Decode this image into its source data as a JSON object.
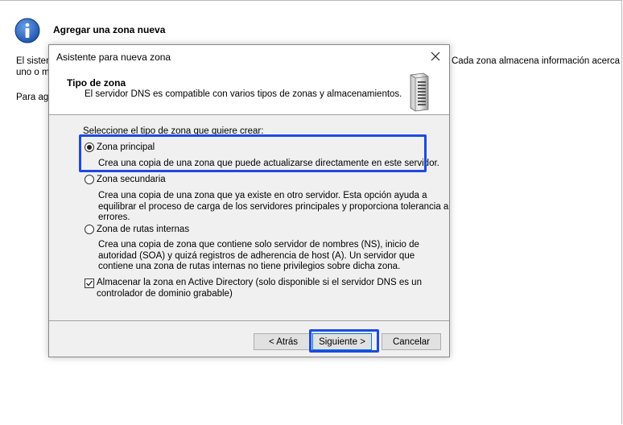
{
  "background": {
    "title": "Agregar una zona nueva",
    "line1_left": "El sistem",
    "line1_right": "Cada zona almacena información acerca",
    "line2_left": "uno o m",
    "line3_left": "Para agr"
  },
  "dialog": {
    "title": "Asistente para nueva zona",
    "header_title": "Tipo de zona",
    "header_subtitle": "El servidor DNS es compatible con varios tipos de zonas y almacenamientos.",
    "prompt": "Seleccione el tipo de zona que quiere crear:",
    "options": [
      {
        "label": "Zona principal",
        "selected": true,
        "desc": [
          "Crea una copia de una zona que puede actualizarse directamente en este servidor."
        ]
      },
      {
        "label": "Zona secundaria",
        "selected": false,
        "desc": [
          "Crea una copia de una zona que ya existe en otro servidor. Esta opción ayuda a",
          "equilibrar el proceso de carga de los servidores principales y proporciona tolerancia a",
          "errores."
        ]
      },
      {
        "label": "Zona de rutas internas",
        "selected": false,
        "desc": [
          "Crea una copia de zona que contiene solo servidor de nombres (NS), inicio de",
          "autoridad (SOA) y quizá registros de adherencia de host (A). Un servidor que",
          "contiene una zona de rutas internas no tiene privilegios sobre dicha zona."
        ]
      }
    ],
    "ad_checkbox": {
      "checked": true,
      "line1": "Almacenar la zona en Active Directory (solo disponible si el servidor DNS es un",
      "line2": "controlador de dominio grabable)"
    },
    "buttons": {
      "back": "< Atrás",
      "next": "Siguiente >",
      "cancel": "Cancelar"
    }
  },
  "colors": {
    "highlight": "#1e49e2",
    "accent": "#0078d7"
  }
}
